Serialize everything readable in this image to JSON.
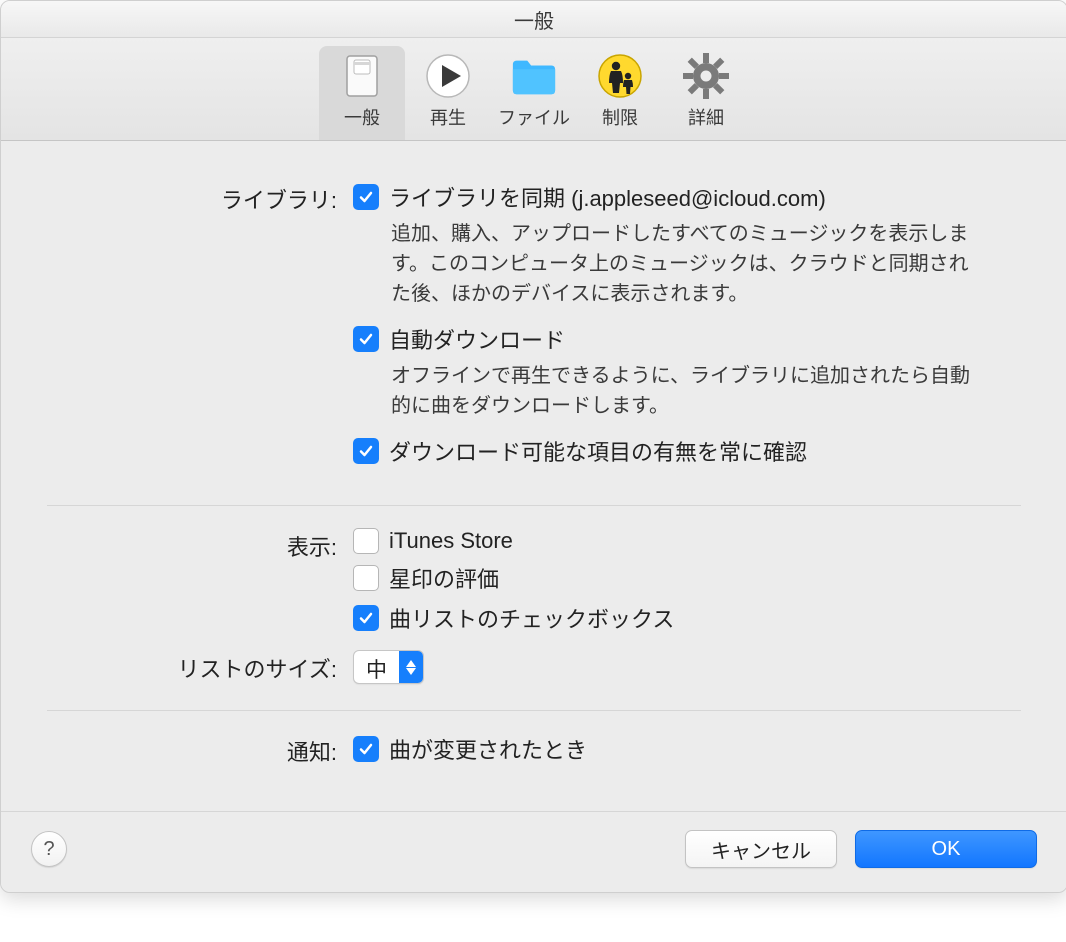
{
  "window": {
    "title": "一般"
  },
  "toolbar": {
    "items": [
      {
        "label": "一般"
      },
      {
        "label": "再生"
      },
      {
        "label": "ファイル"
      },
      {
        "label": "制限"
      },
      {
        "label": "詳細"
      }
    ]
  },
  "library": {
    "section_label": "ライブラリ:",
    "sync_label": "ライブラリを同期  (j.appleseed@icloud.com)",
    "sync_desc": "追加、購入、アップロードしたすべてのミュージックを表示します。このコンピュータ上のミュージックは、クラウドと同期された後、ほかのデバイスに表示されます。",
    "autodl_label": "自動ダウンロード",
    "autodl_desc": "オフラインで再生できるように、ライブラリに追加されたら自動的に曲をダウンロードします。",
    "checkdl_label": "ダウンロード可能な項目の有無を常に確認"
  },
  "display": {
    "section_label": "表示:",
    "itunes_label": "iTunes Store",
    "star_label": "星印の評価",
    "songcb_label": "曲リストのチェックボックス"
  },
  "listsize": {
    "section_label": "リストのサイズ:",
    "value": "中"
  },
  "notify": {
    "section_label": "通知:",
    "songchange_label": "曲が変更されたとき"
  },
  "footer": {
    "help": "?",
    "cancel": "キャンセル",
    "ok": "OK"
  }
}
